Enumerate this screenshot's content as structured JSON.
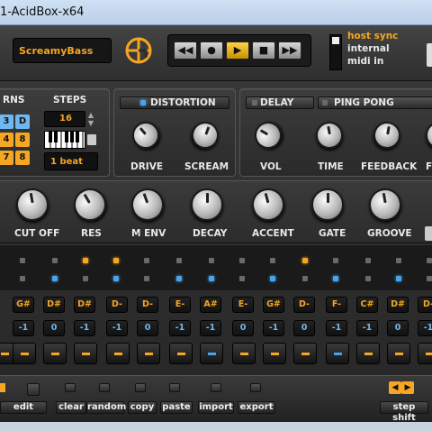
{
  "window": {
    "title": "1-AcidBox-x64"
  },
  "preset": {
    "name": "ScreamyBass"
  },
  "transport": {
    "buttons": [
      {
        "glyph": "◀◀",
        "name": "rewind"
      },
      {
        "glyph": "●",
        "name": "record"
      },
      {
        "glyph": "▶",
        "name": "play"
      },
      {
        "glyph": "■",
        "name": "stop"
      },
      {
        "glyph": "▶▶",
        "name": "forward"
      }
    ]
  },
  "sync": {
    "options": [
      "host sync",
      "internal",
      "midi in"
    ],
    "selected": "host sync"
  },
  "patterns": {
    "label": "RNS",
    "steps_label": "STEPS",
    "steps_value": "16",
    "buttons": [
      "3",
      "D",
      "4",
      "8",
      "7",
      "8"
    ],
    "beat_value": "1 beat"
  },
  "distortion": {
    "title": "DISTORTION",
    "knobs": [
      "DRIVE",
      "SCREAM"
    ]
  },
  "delay": {
    "title": "DELAY",
    "mode": "PING PONG",
    "knobs": [
      "VOL",
      "TIME",
      "FEEDBACK",
      "F"
    ]
  },
  "synth_knobs": [
    "CUT OFF",
    "RES",
    "M ENV",
    "DECAY",
    "ACCENT",
    "GATE",
    "GROOVE"
  ],
  "sequencer": {
    "notes": [
      "G#",
      "D#",
      "D#",
      "D-",
      "D-",
      "E-",
      "A#",
      "E-",
      "G#",
      "D-",
      "F-",
      "C#",
      "D#",
      "D-"
    ],
    "octaves": [
      "-1",
      "0",
      "-1",
      "-1",
      "0",
      "-1",
      "-1",
      "0",
      "-1",
      "0",
      "-1",
      "-1",
      "0",
      "-1"
    ]
  },
  "edit_bar": {
    "edit": "edit",
    "actions": [
      "clear",
      "random",
      "copy",
      "paste",
      "import",
      "export"
    ],
    "step_shift": "step shift"
  },
  "colors": {
    "accent": "#f5a623",
    "blue": "#4aa3e8"
  }
}
